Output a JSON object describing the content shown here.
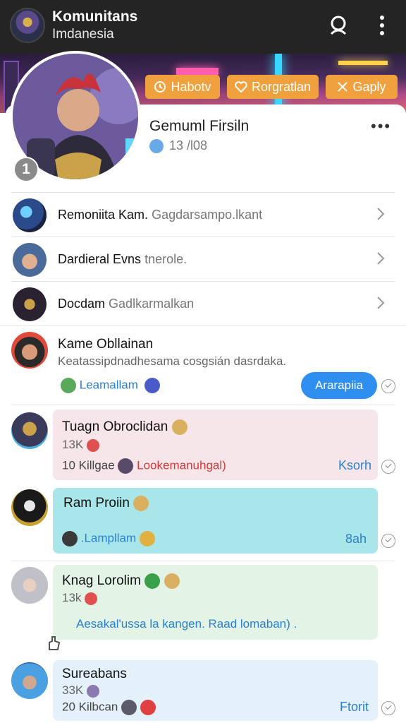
{
  "header": {
    "title": "Komunitans",
    "subtitle": "Imdanesia",
    "search_icon": "person-search-icon",
    "menu_icon": "more-vertical-icon"
  },
  "banner_actions": [
    {
      "label": "Habotv",
      "icon": "clock-icon"
    },
    {
      "label": "Rorgratlan",
      "icon": "heart-icon"
    },
    {
      "label": "Gaply",
      "icon": "close-icon"
    }
  ],
  "profile": {
    "name": "Gemuml Firsiln",
    "meta": "13 /l08",
    "badge": "1"
  },
  "menu_rows": [
    {
      "title": "Remoniita Kam.",
      "detail": "Gagdarsampo.lkant"
    },
    {
      "title": "Dardieral Evns",
      "detail": "tnerole."
    },
    {
      "title": "Docdam",
      "detail": "Gadlkarmalkan"
    }
  ],
  "messages": [
    {
      "name": "Kame Obllainan",
      "text": "Keatassipdnadhesama cosgsián dasrdaka.",
      "link": "Leamallam",
      "button": "Ararapiia"
    },
    {
      "name": "Tuagn Obroclidan",
      "count": "13K",
      "line": "10 Killgae",
      "link": "Lookemanuhgal)",
      "time": "Ksorh"
    },
    {
      "name": "Ram Proiin",
      "link": ".Lampllam",
      "time": "8ah"
    },
    {
      "name": "Knag Lorolim",
      "count": "13k",
      "text": "Aesakal'ussa la kangen. Raad lomaban) ."
    },
    {
      "name": "Sureabans",
      "count": "33K",
      "line": "20 Kilbcan",
      "time": "Ftorit"
    }
  ],
  "colors": {
    "topbar": "#242424",
    "accent_orange": "#f0a03c",
    "accent_blue": "#2e8ff0",
    "bubble_pink": "#f6e6ea",
    "bubble_cyan": "#a9e6ea",
    "bubble_green": "#e3f3e6",
    "bubble_blue": "#e4f1fb"
  }
}
